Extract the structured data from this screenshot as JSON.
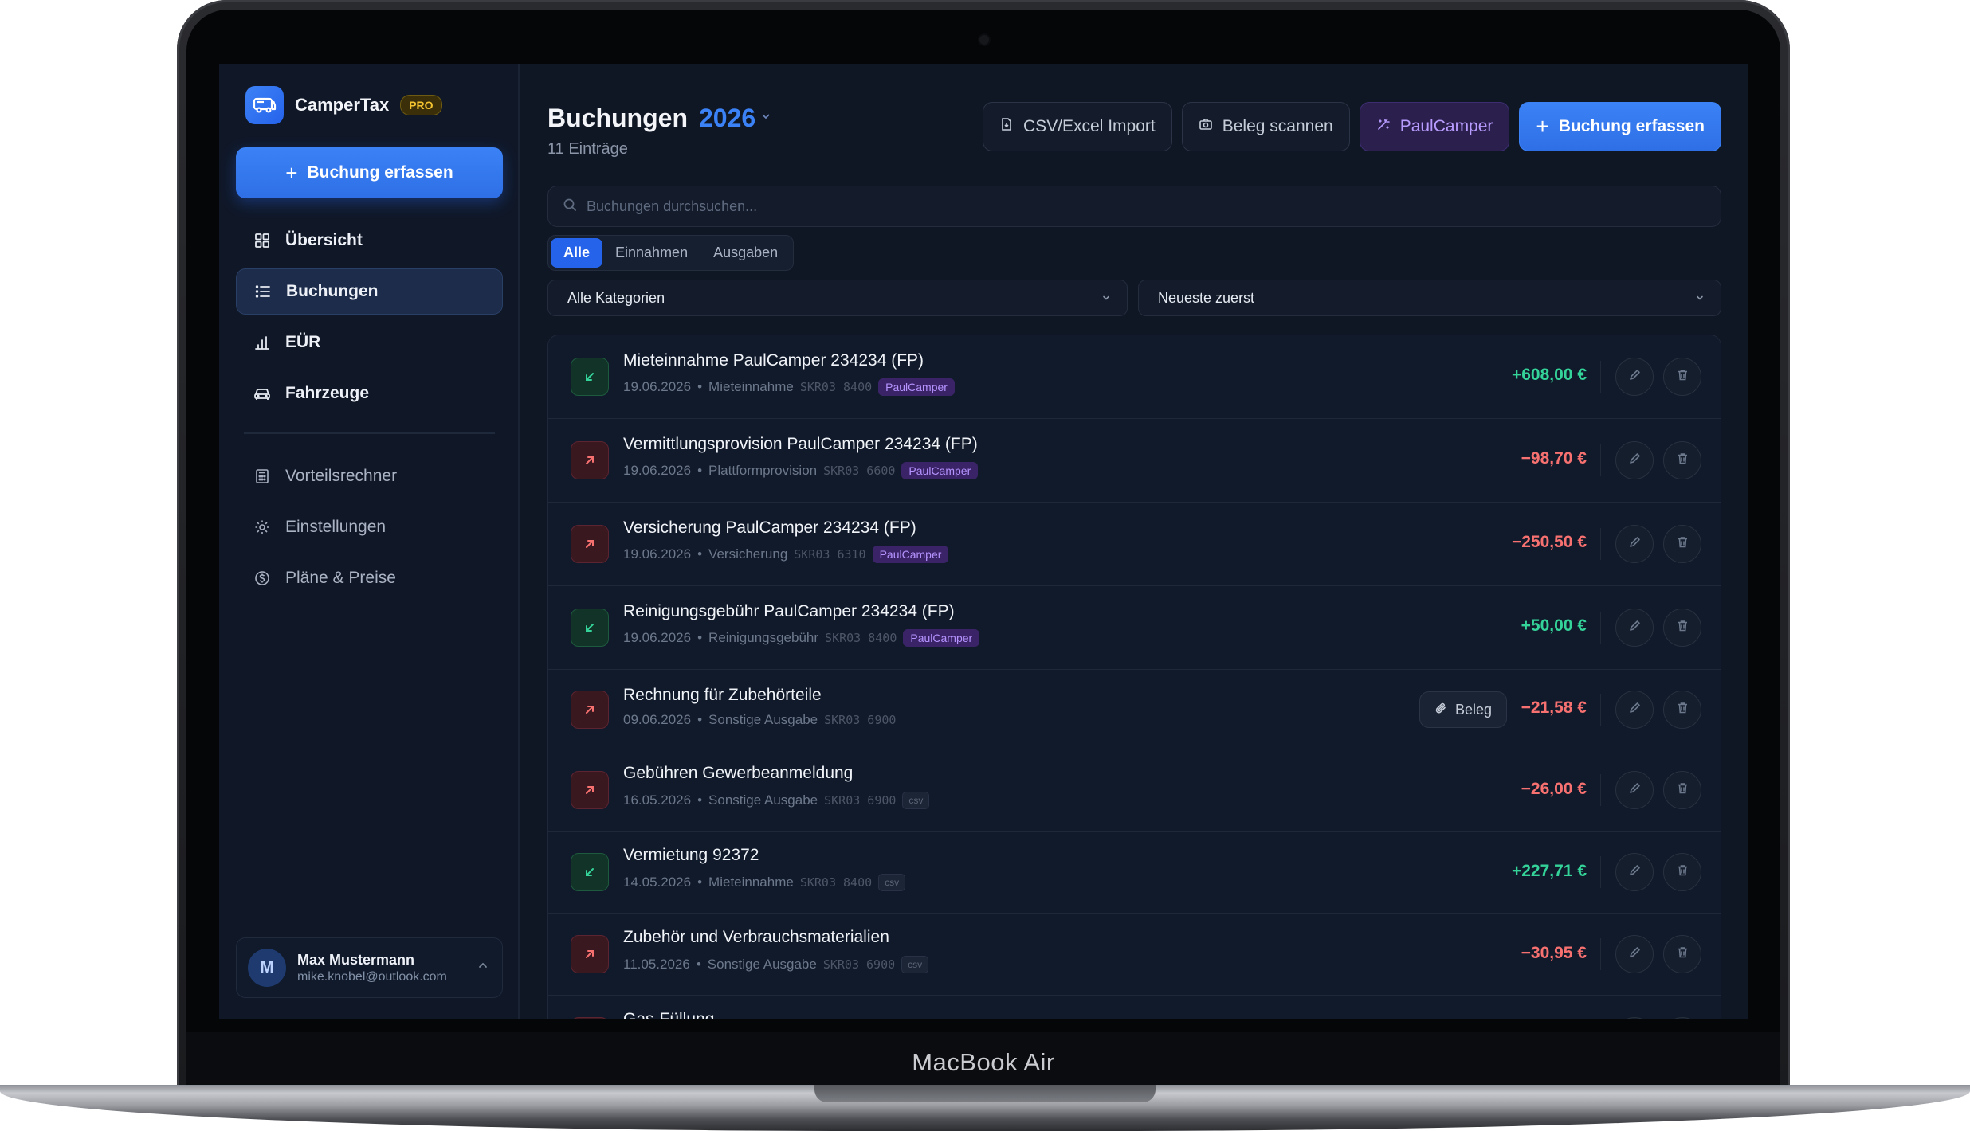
{
  "device_label": "MacBook Air",
  "app": {
    "name": "CamperTax",
    "plan_badge": "PRO"
  },
  "sidebar": {
    "cta_label": "Buchung erfassen",
    "items": [
      {
        "label": "Übersicht",
        "icon": "grid-icon",
        "active": false
      },
      {
        "label": "Buchungen",
        "icon": "list-icon",
        "active": true
      },
      {
        "label": "EÜR",
        "icon": "bar-chart-icon",
        "active": false
      },
      {
        "label": "Fahrzeuge",
        "icon": "car-icon",
        "active": false
      }
    ],
    "secondary_items": [
      {
        "label": "Vorteilsrechner",
        "icon": "calculator-icon"
      },
      {
        "label": "Einstellungen",
        "icon": "gear-icon"
      },
      {
        "label": "Pläne & Preise",
        "icon": "dollar-circle-icon"
      }
    ],
    "user": {
      "initial": "M",
      "name": "Max Mustermann",
      "email": "mike.knobel@outlook.com"
    }
  },
  "header": {
    "title": "Buchungen",
    "year": "2026",
    "subtitle": "11 Einträge",
    "buttons": {
      "import": "CSV/Excel Import",
      "scan": "Beleg scannen",
      "paulcamper": "PaulCamper",
      "new": "Buchung erfassen"
    }
  },
  "search": {
    "placeholder": "Buchungen durchsuchen..."
  },
  "filters": {
    "all": "Alle",
    "income": "Einnahmen",
    "expenses": "Ausgaben",
    "selected": "Alle"
  },
  "category_select": {
    "value": "Alle Kategorien"
  },
  "sort_select": {
    "value": "Neueste zuerst"
  },
  "bookings": [
    {
      "title": "Mieteinnahme PaulCamper 234234 (FP)",
      "date": "19.06.2026",
      "category": "Mieteinnahme",
      "account": "SKR03 8400",
      "tag": "PaulCamper",
      "amount": "+608,00 €",
      "type": "in"
    },
    {
      "title": "Vermittlungsprovision PaulCamper 234234 (FP)",
      "date": "19.06.2026",
      "category": "Plattformprovision",
      "account": "SKR03 6600",
      "tag": "PaulCamper",
      "amount": "−98,70 €",
      "type": "out"
    },
    {
      "title": "Versicherung PaulCamper 234234 (FP)",
      "date": "19.06.2026",
      "category": "Versicherung",
      "account": "SKR03 6310",
      "tag": "PaulCamper",
      "amount": "−250,50 €",
      "type": "out"
    },
    {
      "title": "Reinigungsgebühr PaulCamper 234234 (FP)",
      "date": "19.06.2026",
      "category": "Reinigungsgebühr",
      "account": "SKR03 8400",
      "tag": "PaulCamper",
      "amount": "+50,00 €",
      "type": "in"
    },
    {
      "title": "Rechnung für Zubehörteile",
      "date": "09.06.2026",
      "category": "Sonstige Ausgabe",
      "account": "SKR03 6900",
      "tag": "",
      "beleg": "Beleg",
      "amount": "−21,58 €",
      "type": "out"
    },
    {
      "title": "Gebühren Gewerbeanmeldung",
      "date": "16.05.2026",
      "category": "Sonstige Ausgabe",
      "account": "SKR03 6900",
      "tag": "csv",
      "amount": "−26,00 €",
      "type": "out"
    },
    {
      "title": "Vermietung 92372",
      "date": "14.05.2026",
      "category": "Mieteinnahme",
      "account": "SKR03 8400",
      "tag": "csv",
      "amount": "+227,71 €",
      "type": "in"
    },
    {
      "title": "Zubehör und Verbrauchsmaterialien",
      "date": "11.05.2026",
      "category": "Sonstige Ausgabe",
      "account": "SKR03 6900",
      "tag": "csv",
      "amount": "−30,95 €",
      "type": "out"
    },
    {
      "title": "Gas-Füllung",
      "type": "out"
    }
  ],
  "meta_separator": "•",
  "colors": {
    "accent": "#3b82f6",
    "income": "#34d399",
    "expense": "#f87171",
    "paulcamper": "#b693ff"
  }
}
